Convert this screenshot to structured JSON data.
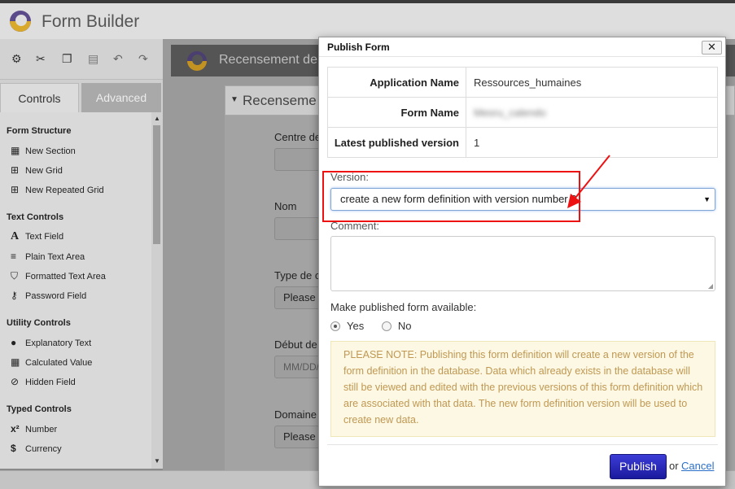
{
  "app": {
    "title": "Form Builder"
  },
  "toolbar": {
    "icons": [
      "gear-icon",
      "cut-icon",
      "copy-icon",
      "paste-icon",
      "undo-icon",
      "redo-icon"
    ]
  },
  "tabs": {
    "controls": "Controls",
    "advanced": "Advanced"
  },
  "palette": {
    "groups": [
      {
        "label": "Form Structure",
        "items": [
          {
            "label": "New Section",
            "icon": "section-icon"
          },
          {
            "label": "New Grid",
            "icon": "grid-icon"
          },
          {
            "label": "New Repeated Grid",
            "icon": "repeated-grid-icon"
          }
        ]
      },
      {
        "label": "Text Controls",
        "items": [
          {
            "label": "Text Field",
            "icon": "text-field-icon"
          },
          {
            "label": "Plain Text Area",
            "icon": "text-area-icon"
          },
          {
            "label": "Formatted Text Area",
            "icon": "html5-icon"
          },
          {
            "label": "Password Field",
            "icon": "key-icon"
          }
        ]
      },
      {
        "label": "Utility Controls",
        "items": [
          {
            "label": "Explanatory Text",
            "icon": "speech-bubble-icon"
          },
          {
            "label": "Calculated Value",
            "icon": "calculator-icon"
          },
          {
            "label": "Hidden Field",
            "icon": "eye-slash-icon"
          }
        ]
      },
      {
        "label": "Typed Controls",
        "items": [
          {
            "label": "Number",
            "icon": "superscript-icon"
          },
          {
            "label": "Currency",
            "icon": "dollar-icon"
          }
        ]
      }
    ]
  },
  "main": {
    "header_title": "Recensement de",
    "section_title": "Recenseme",
    "fields": {
      "centre": "Centre de",
      "nom": "Nom",
      "type": "Type de c",
      "type_value": "Please",
      "debut": "Début de",
      "debut_placeholder": "MM/DD/",
      "domaine": "Domaine",
      "domaine_value": "Please"
    }
  },
  "modal": {
    "title": "Publish Form",
    "close_glyph": "✕",
    "info": {
      "app_name_label": "Application Name",
      "app_name_value": "Ressources_humaines",
      "form_name_label": "Form Name",
      "form_name_value": "Mesru_calendo",
      "latest_label": "Latest published version",
      "latest_value": "1"
    },
    "version_label": "Version:",
    "version_value": "create a new form definition with version number 2",
    "comment_label": "Comment:",
    "available_label": "Make published form available:",
    "available_yes": "Yes",
    "available_no": "No",
    "available_selected": "Yes",
    "note": "PLEASE NOTE: Publishing this form definition will create a new version of the form definition in the database. Data which already exists in the database will still be viewed and edited with the previous versions of this form definition which are associated with that data. The new form definition version will be used to create new data.",
    "publish_label": "Publish",
    "or_text": "or",
    "cancel_label": "Cancel"
  },
  "colors": {
    "accent_publish": "#2222b8",
    "note_bg": "#fcf8e3",
    "note_text": "#c09853",
    "annotation": "#ee1111",
    "link": "#2a6fc9"
  }
}
